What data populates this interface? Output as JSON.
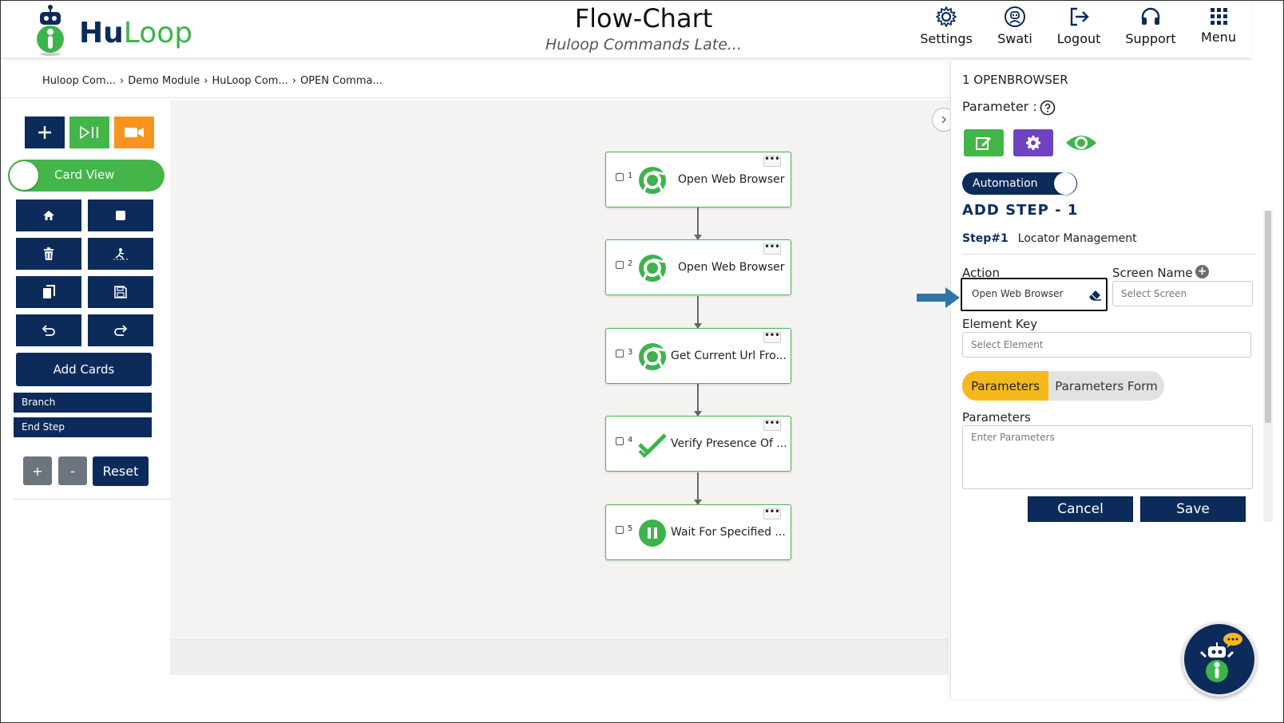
{
  "app": {
    "logo_prefix": "Hu",
    "logo_suffix": "Loop",
    "title": "Flow-Chart",
    "subtitle": "Huloop Commands Late..."
  },
  "nav": [
    {
      "label": "Settings",
      "icon": "gear-icon"
    },
    {
      "label": "Swati",
      "icon": "user-icon"
    },
    {
      "label": "Logout",
      "icon": "logout-icon"
    },
    {
      "label": "Support",
      "icon": "headset-icon"
    },
    {
      "label": "Menu",
      "icon": "grid-icon"
    }
  ],
  "breadcrumb": [
    "Huloop Com...",
    "Demo Module",
    "HuLoop Com...",
    "OPEN Comma..."
  ],
  "toolbar": {
    "card_view_label": "Card View",
    "add_cards_label": "Add Cards",
    "branch_label": "Branch",
    "end_step_label": "End Step",
    "zoom_in_label": "+",
    "zoom_out_label": "-",
    "reset_label": "Reset"
  },
  "flow_cards": [
    {
      "number": "1",
      "label": "Open Web Browser",
      "icon": "chrome-icon",
      "more": "•••"
    },
    {
      "number": "2",
      "label": "Open Web Browser",
      "icon": "chrome-icon",
      "more": "•••"
    },
    {
      "number": "3",
      "label": "Get Current Url Fro...",
      "icon": "chrome-icon",
      "more": "•••"
    },
    {
      "number": "4",
      "label": "Verify Presence Of ...",
      "icon": "checkmark-icon",
      "more": "•••"
    },
    {
      "number": "5",
      "label": "Wait For Specified ...",
      "icon": "pause-icon",
      "more": "•••"
    }
  ],
  "panel": {
    "step_title": "1 OPENBROWSER",
    "parameter_label": "Parameter :",
    "automation_label": "Automation",
    "add_step_title": "ADD STEP - 1",
    "step_number": "Step#1",
    "step_tab": "Locator Management",
    "action_label": "Action",
    "action_value": "Open Web Browser",
    "screen_name_label": "Screen Name",
    "screen_placeholder": "Select Screen",
    "element_key_label": "Element Key",
    "element_placeholder": "Select Element",
    "tab_parameters": "Parameters",
    "tab_parameters_form": "Parameters Form",
    "parameters_label": "Parameters",
    "parameters_placeholder": "Enter Parameters",
    "cancel_label": "Cancel",
    "save_label": "Save"
  },
  "colors": {
    "navy": "#0d2b5a",
    "green": "#44b549",
    "orange": "#f7941d",
    "purple": "#6f42c1",
    "yellow_tab": "#f5b81d",
    "canvas_bg": "#f4f3f2"
  }
}
